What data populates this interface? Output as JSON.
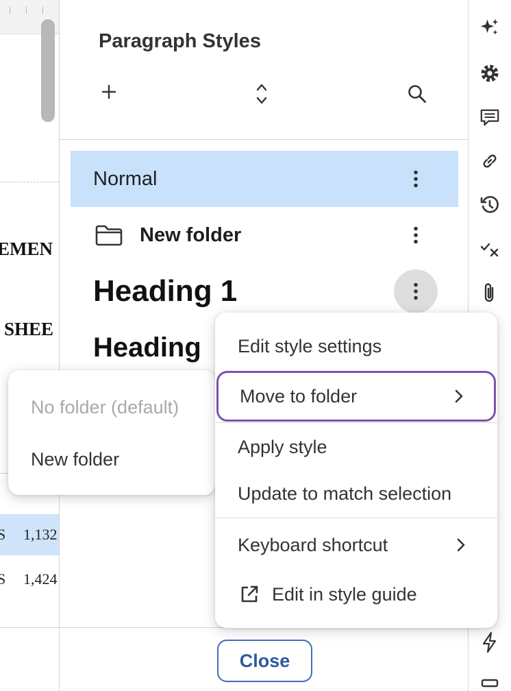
{
  "document": {
    "text_line_1": "EMEN",
    "text_line_2": "SHEE",
    "row_1": {
      "col_a": "S",
      "col_b": "1,132"
    },
    "row_2": {
      "col_a": "S",
      "col_b": "1,424"
    }
  },
  "panel": {
    "title": "Paragraph Styles",
    "icons": {
      "add": "plus-icon",
      "sort": "sort-icon",
      "search": "search-icon"
    },
    "styles": [
      {
        "label": "Normal",
        "selected": true
      },
      {
        "label": "New folder",
        "is_folder": true
      },
      {
        "label": "Heading 1"
      },
      {
        "label": "Heading"
      }
    ],
    "close_label": "Close"
  },
  "context_menu": {
    "items": [
      {
        "label": "Edit style settings"
      },
      {
        "label": "Move to folder",
        "has_submenu": true,
        "highlighted": true
      },
      {
        "label": "Apply style"
      },
      {
        "label": "Update to match selection"
      },
      {
        "label": "Keyboard shortcut",
        "has_submenu": true
      },
      {
        "label": "Edit in style guide",
        "icon": "external-link-icon"
      }
    ],
    "highlight_color": "#7d4fb0"
  },
  "submenu": {
    "items": [
      {
        "label": "No folder (default)",
        "disabled": true
      },
      {
        "label": "New folder"
      }
    ]
  },
  "rail": {
    "icons": [
      "sparkle-icon",
      "gear-icon",
      "comment-icon",
      "link-icon",
      "history-icon",
      "check-x-icon",
      "paperclip-icon",
      "lightning-icon",
      "minus-icon"
    ]
  },
  "colors": {
    "selected_row": "#c9e1fb",
    "accent_blue": "#2c5aa0"
  }
}
